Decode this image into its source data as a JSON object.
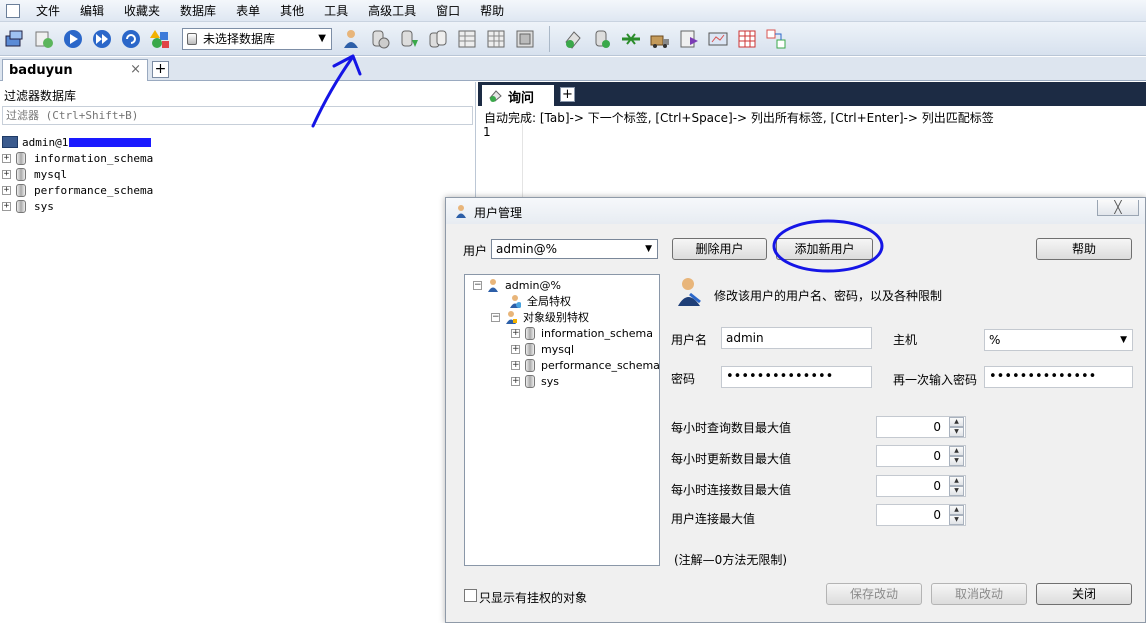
{
  "menu": [
    "文件",
    "编辑",
    "收藏夹",
    "数据库",
    "表单",
    "其他",
    "工具",
    "高级工具",
    "窗口",
    "帮助"
  ],
  "toolbar": {
    "db_selector": "未选择数据库",
    "icons_left": [
      "new-connection-icon",
      "open-file-icon",
      "run-icon",
      "run-all-icon",
      "refresh-icon",
      "color-shapes-icon"
    ],
    "icons_right": [
      "user-manager-icon",
      "backup-db-icon",
      "restore-db-icon",
      "copy-db-icon",
      "table-export-icon",
      "table-import-icon",
      "schema-sync-icon",
      "sql-icon",
      "data-sync-icon",
      "import-wizard-icon",
      "transfer-icon",
      "monitor-icon",
      "report-icon",
      "schema-designer-icon",
      "arrange-icon"
    ],
    "colors": {
      "accent": "#2f5fb3",
      "annotation": "#1515e6"
    }
  },
  "connection_tab": {
    "label": "baduyun",
    "close": "×",
    "add": "+"
  },
  "left": {
    "filter_label": "过滤器数据库",
    "filter_placeholder": "过滤器 (Ctrl+Shift+B)",
    "server": "admin@1",
    "databases": [
      "information_schema",
      "mysql",
      "performance_schema",
      "sys"
    ]
  },
  "query": {
    "tab": "询问",
    "add": "+",
    "autocomplete": "自动完成: [Tab]-> 下一个标签, [Ctrl+Space]-> 列出所有标签, [Ctrl+Enter]-> 列出匹配标签",
    "line_number": "1"
  },
  "dialog": {
    "title": "用户管理",
    "close": "╳",
    "user_label": "用户",
    "user_value": "admin@%",
    "delete_btn": "删除用户",
    "add_btn": "添加新用户",
    "help_btn": "帮助",
    "tree": {
      "root": "admin@%",
      "global": "全局特权",
      "object": "对象级别特权",
      "databases": [
        "information_schema",
        "mysql",
        "performance_schema",
        "sys"
      ]
    },
    "desc": "修改该用户的用户名、密码，以及各种限制",
    "username_label": "用户名",
    "username_value": "admin",
    "host_label": "主机",
    "host_value": "%",
    "password_label": "密码",
    "password_value": "••••••••••••••",
    "repeat_label": "再一次输入密码",
    "repeat_value": "••••••••••••••",
    "limits": [
      {
        "label": "每小时查询数目最大值",
        "value": "0"
      },
      {
        "label": "每小时更新数目最大值",
        "value": "0"
      },
      {
        "label": "每小时连接数目最大值",
        "value": "0"
      },
      {
        "label": "用户连接最大值",
        "value": "0"
      }
    ],
    "note": "(注解—0方法无限制)",
    "show_only_label": "只显示有挂权的对象",
    "save_btn": "保存改动",
    "cancel_btn": "取消改动",
    "close_btn": "关闭"
  }
}
